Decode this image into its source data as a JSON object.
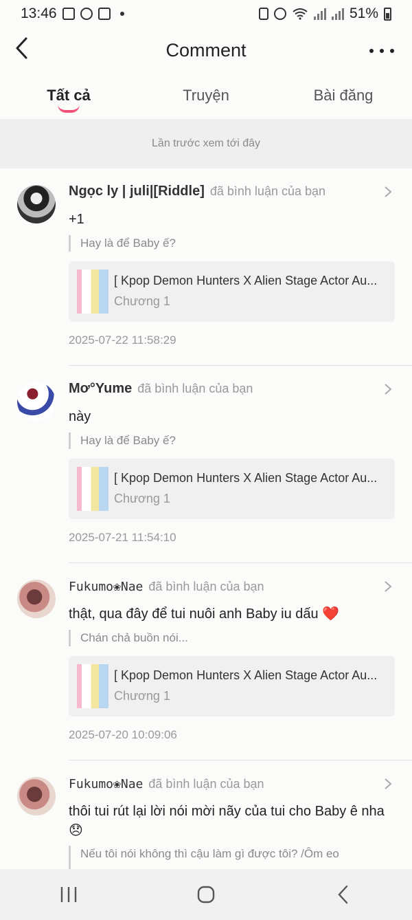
{
  "status_bar": {
    "time": "13:46",
    "battery": "51%",
    "left_icons": [
      "gallery-icon",
      "pinterest-icon",
      "checkbox-icon",
      "dot-icon"
    ],
    "right_icons": [
      "battery-saver-icon",
      "alarm-icon",
      "wifi-icon",
      "signal-icon",
      "signal-icon",
      "battery-icon"
    ]
  },
  "header": {
    "title": "Comment"
  },
  "tabs": [
    {
      "label": "Tất cả",
      "active": true
    },
    {
      "label": "Truyện",
      "active": false
    },
    {
      "label": "Bài đăng",
      "active": false
    }
  ],
  "accent_color": "#f0527a",
  "last_seen": "Lần trước xem tới đây",
  "comments": [
    {
      "user": "Ngọc ly | juli|[Riddle]",
      "action": "đã bình luận của bạn",
      "text": "+1",
      "quote": "Hay là để Baby ế?",
      "story_title": "[ Kpop Demon Hunters X Alien Stage Actor Au...",
      "chapter": "Chương 1",
      "timestamp": "2025-07-22 11:58:29"
    },
    {
      "user": "Mơ°Yume",
      "action": "đã bình luận của bạn",
      "text": "này",
      "quote": "Hay là để Baby ế?",
      "story_title": "[ Kpop Demon Hunters X Alien Stage Actor Au...",
      "chapter": "Chương 1",
      "timestamp": "2025-07-21 11:54:10"
    },
    {
      "user": "Fukumo❀Nae",
      "action": "đã bình luận của bạn",
      "text": "thật, qua đây để tui nuôi anh Baby iu dấu ❤️",
      "quote": "Chán chả buồn nói...",
      "story_title": "[ Kpop Demon Hunters X Alien Stage Actor Au...",
      "chapter": "Chương 1",
      "timestamp": "2025-07-20 10:09:06"
    },
    {
      "user": "Fukumo❀Nae",
      "action": "đã bình luận của bạn",
      "text": "thôi tui rút lại lời nói mời nãy của tui cho Baby ê nha😞",
      "quote": "Nếu tôi nói không thì cậu làm gì được tôi? /Ôm eo"
    }
  ],
  "nav": [
    "recent-apps-icon",
    "home-icon",
    "back-icon"
  ]
}
